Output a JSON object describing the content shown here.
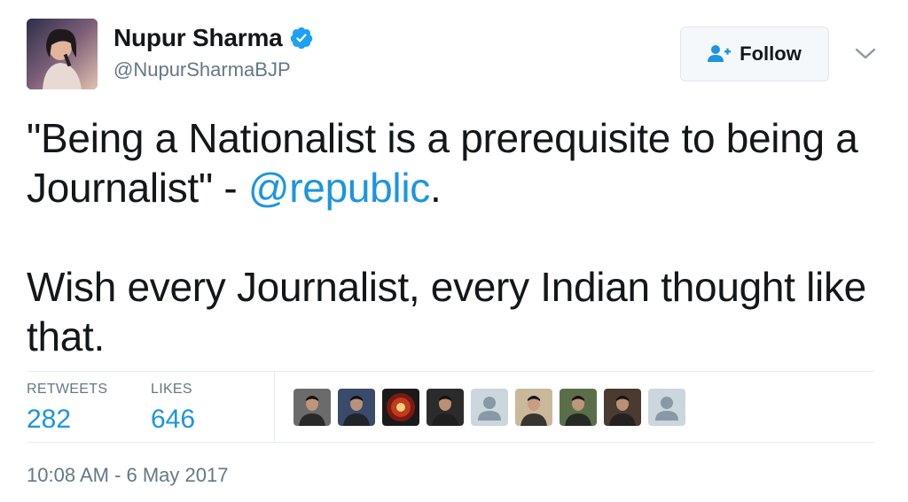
{
  "user": {
    "name": "Nupur Sharma",
    "handle": "@NupurSharmaBJP",
    "verified": true
  },
  "follow_button": {
    "label": "Follow",
    "icon": "add-user-icon"
  },
  "menu_caret": {
    "icon": "chevron-down-icon"
  },
  "tweet": {
    "line1_part1": "\"Being a Nationalist is a prerequisite to being a Journalist\" - ",
    "mention": "@republic",
    "line1_part2": ".",
    "paragraph2": "Wish every Journalist, every Indian thought like that."
  },
  "stats": {
    "retweets_label": "RETWEETS",
    "retweets_value": "282",
    "likes_label": "LIKES",
    "likes_value": "646"
  },
  "likers": [
    {
      "type": "photo",
      "bg": "#6b6b6b"
    },
    {
      "type": "photo",
      "bg": "#3a4a6b"
    },
    {
      "type": "badge",
      "bg": "#1a1a1a"
    },
    {
      "type": "photo",
      "bg": "#2b2b2b"
    },
    {
      "type": "default",
      "bg": "#ccd6dd"
    },
    {
      "type": "photo",
      "bg": "#c9b89a"
    },
    {
      "type": "photo",
      "bg": "#5b6e4a"
    },
    {
      "type": "photo",
      "bg": "#4a3a30"
    },
    {
      "type": "default",
      "bg": "#ccd6dd"
    }
  ],
  "timestamp": "10:08 AM - 6 May 2017",
  "colors": {
    "link": "#1b95e0",
    "muted": "#657786",
    "text": "#14171a",
    "border": "#e6ecf0"
  }
}
